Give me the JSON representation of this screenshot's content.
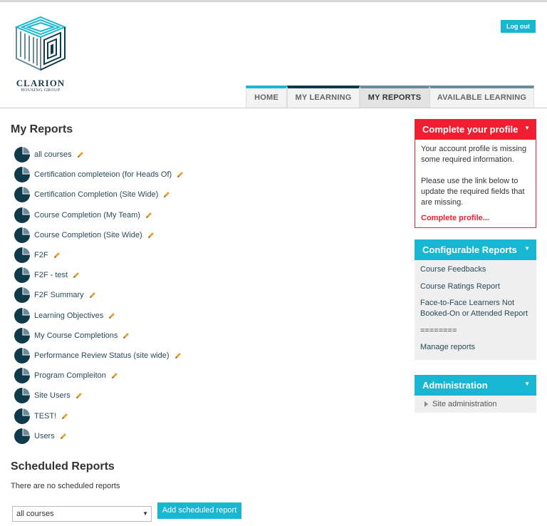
{
  "logo": {
    "name": "CLARION",
    "sub": "HOUSING GROUP"
  },
  "header": {
    "logout": "Log out"
  },
  "nav": {
    "tabs": [
      "HOME",
      "MY LEARNING",
      "MY REPORTS",
      "AVAILABLE LEARNING"
    ]
  },
  "main": {
    "title": "My Reports",
    "reports": [
      "all courses",
      "Certification completeion (for Heads Of)",
      "Certification Completion (Site Wide)",
      "Course Completion (My Team)",
      "Course Completion (Site Wide)",
      "F2F",
      "F2F - test",
      "F2F Summary",
      "Learning Objectives",
      "My Course Completions",
      "Performance Review Status (site wide)",
      "Program Compleiton",
      "Site Users",
      "TEST!",
      "Users"
    ],
    "scheduled_title": "Scheduled Reports",
    "no_scheduled": "There are no scheduled reports",
    "select_value": "all courses",
    "add_button": "Add scheduled report"
  },
  "profile_block": {
    "title": "Complete your profile",
    "text1": "Your account profile is missing some required information.",
    "text2": "Please use the link below to update the required fields that are missing.",
    "link": "Complete profile..."
  },
  "config_block": {
    "title": "Configurable Reports",
    "items": [
      "Course Feedbacks",
      "Course Ratings Report",
      "Face-to-Face Learners Not Booked-On or Attended Report",
      "========",
      "Manage reports"
    ]
  },
  "admin_block": {
    "title": "Administration",
    "item": "Site administration"
  },
  "colors": {
    "accent": "#17b7d1",
    "alert": "#ef1e30",
    "dark": "#0f3a4a"
  },
  "icons": {
    "report": "pie-chart-icon",
    "edit": "pencil-icon",
    "collapse": "chevron-down-icon"
  }
}
